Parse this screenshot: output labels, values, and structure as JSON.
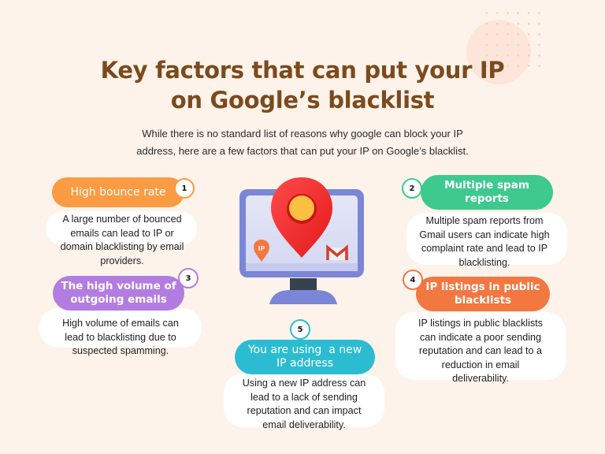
{
  "title_line1": "Key factors that can put your IP",
  "title_line2": "on Google’s blacklist",
  "subtitle_line1": "While there is no standard list of reasons why google can block your IP",
  "subtitle_line2": "address, here are a few factors that can put your IP on Google’s blacklist.",
  "colors": {
    "background": "#fef3ea",
    "title": "#7b4a1d",
    "factor1": "#fb9b43",
    "factor2": "#3ec98f",
    "factor3": "#b37ce0",
    "factor4": "#f27741",
    "factor5": "#2bbcd2"
  },
  "illustration": {
    "icons": [
      "monitor-icon",
      "location-pin-icon",
      "ip-pin-icon",
      "gmail-icon"
    ],
    "ip_label": "IP"
  },
  "factors": [
    {
      "number": "1",
      "heading": "High bounce rate",
      "desc_lines": [
        "A large number of bounced",
        "emails can lead to IP or",
        "domain blacklisting by email",
        "providers."
      ]
    },
    {
      "number": "2",
      "heading_lines": [
        "Multiple spam",
        "reports"
      ],
      "desc_lines": [
        "Multiple spam reports from",
        "Gmail users can indicate high",
        "complaint rate and lead to IP",
        "blacklisting."
      ]
    },
    {
      "number": "3",
      "heading_lines": [
        "The high volume of",
        "outgoing emails"
      ],
      "desc_lines": [
        "High volume of emails can",
        "lead to blacklisting due to",
        "suspected spamming."
      ]
    },
    {
      "number": "4",
      "heading_lines": [
        "IP listings in public",
        "blacklists"
      ],
      "desc_lines": [
        "IP listings in public blacklists",
        "can indicate a poor sending",
        "reputation and can lead to a",
        "reduction in email",
        "deliverability."
      ]
    },
    {
      "number": "5",
      "heading_lines": [
        "You are using  a new",
        "IP address"
      ],
      "desc_lines": [
        "Using a new IP address can",
        "lead to a lack of sending",
        "reputation and can impact",
        "email deliverability."
      ]
    }
  ]
}
